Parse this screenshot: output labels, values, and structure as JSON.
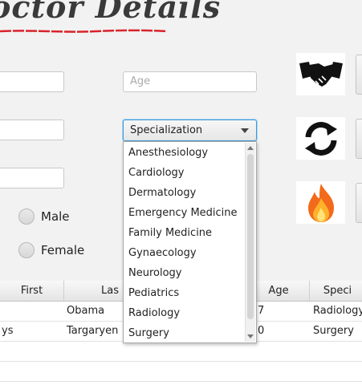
{
  "header": {
    "title": "octor Details"
  },
  "form": {
    "age_placeholder": "Age",
    "specialization": {
      "selected": "Specialization"
    },
    "gender_options": [
      "Male",
      "Female"
    ]
  },
  "actions": {
    "icons": [
      "handshake-icon",
      "refresh-icon",
      "fire-icon"
    ]
  },
  "dropdown": {
    "options": [
      "Anesthesiology",
      "Cardiology",
      "Dermatology",
      "Emergency Medicine",
      "Family Medicine",
      "Gynaecology",
      "Neurology",
      "Pediatrics",
      "Radiology",
      "Surgery"
    ]
  },
  "table": {
    "headers": {
      "first": "First",
      "last": "Las",
      "age": "Age",
      "spec": "Speci"
    },
    "rows": [
      {
        "first": "",
        "last": "Obama",
        "age": "7",
        "spec": "Radiology"
      },
      {
        "first": "ys",
        "last": "Targaryen",
        "age": "0",
        "spec": "Surgery"
      }
    ]
  },
  "colors": {
    "accent": "#3f9ad6",
    "underline": "#d9232a"
  }
}
